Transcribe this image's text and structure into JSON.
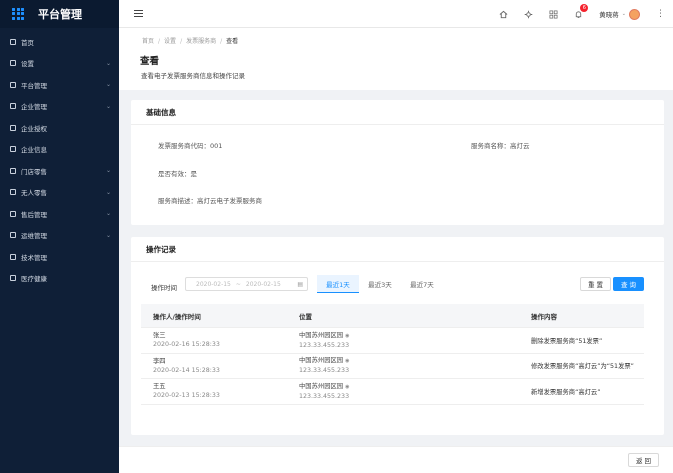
{
  "app": {
    "title": "平台管理"
  },
  "sidebar": {
    "items": [
      {
        "label": "首页",
        "chevron": false
      },
      {
        "label": "设置",
        "chevron": true
      },
      {
        "label": "平台管理",
        "chevron": true
      },
      {
        "label": "企业管理",
        "chevron": true
      },
      {
        "label": "企业授权",
        "chevron": false
      },
      {
        "label": "企业信息",
        "chevron": false
      },
      {
        "label": "门店零售",
        "chevron": true
      },
      {
        "label": "无人零售",
        "chevron": true
      },
      {
        "label": "售后管理",
        "chevron": true
      },
      {
        "label": "运维管理",
        "chevron": true
      },
      {
        "label": "技术管理",
        "chevron": false
      },
      {
        "label": "医疗健康",
        "chevron": false
      }
    ]
  },
  "header": {
    "badge_count": "6",
    "user_name": "黄晓蒋"
  },
  "breadcrumb": [
    "首页",
    "设置",
    "发票服务商",
    "查看"
  ],
  "page": {
    "title": "查看",
    "description": "查看电子发票服务商信息和操作记录"
  },
  "basic_info": {
    "title": "基础信息",
    "code_label": "发票服务商代码：",
    "code_value": "001",
    "name_label": "服务商名称：",
    "name_value": "高灯云",
    "valid_label": "是否有效：",
    "valid_value": "是",
    "desc_label": "服务商描述：",
    "desc_value": "高灯云电子发票服务商"
  },
  "records": {
    "title": "操作记录",
    "time_label": "操作时间",
    "date_start": "2020-02-15",
    "date_end": "2020-02-15",
    "range_sep": "~",
    "tabs": [
      "最近1天",
      "最近3天",
      "最近7天"
    ],
    "active_tab": 0,
    "reset_label": "重 置",
    "query_label": "查 询",
    "columns": [
      "操作人/操作时间",
      "位置",
      "操作内容"
    ],
    "rows": [
      {
        "user": "张三",
        "time": "2020-02-16 15:28:33",
        "location": "中国苏州园区园",
        "ip": "123.33.455.233",
        "content": "删除发票服务商“51发票”"
      },
      {
        "user": "李四",
        "time": "2020-02-14 15:28:33",
        "location": "中国苏州园区园",
        "ip": "123.33.455.233",
        "content": "修改发票服务商“高灯云”为“51发票”"
      },
      {
        "user": "王五",
        "time": "2020-02-13 15:28:33",
        "location": "中国苏州园区园",
        "ip": "123.33.455.233",
        "content": "新增发票服务商“高灯云”"
      }
    ]
  },
  "footer": {
    "back_label": "返 回"
  }
}
